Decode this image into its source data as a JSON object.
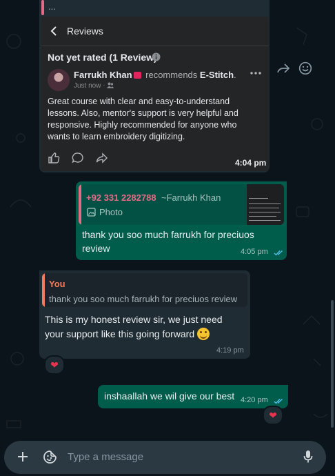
{
  "colors": {
    "chat_background": "#0b141a",
    "incoming_bubble": "#202c33",
    "outgoing_bubble": "#005c4b",
    "quote_pink": "#e26b86",
    "quote_orange": "#f27c59",
    "read_ticks": "#53bdeb",
    "heart": "#e8344e"
  },
  "top_message": {
    "quote_snippet": "...",
    "screenshot": {
      "header_title": "Reviews",
      "rating_line": "Not yet rated (1 Review)",
      "reviewer_name": "Farrukh Khan",
      "recommends_word": "recommends",
      "page_name": "E-Stitch",
      "posted_time": "Just now ·",
      "review_text": "Great course with clear and easy-to-understand lessons. Also, mentor's support is very helpful and responsive. Highly recommended for anyone who wants to learn embroidery digitizing."
    },
    "time": "4:04 pm",
    "side_icons": [
      "forward-icon",
      "emoji-reaction-icon"
    ]
  },
  "reply_message": {
    "quoted_phone": "+92 331 2282788",
    "quoted_name": "~Farrukh Khan",
    "quoted_type": "Photo",
    "text": "thank you soo much farrukh for preciuos review",
    "time": "4:05 pm",
    "status": "read"
  },
  "incoming_reply": {
    "quoted_author": "You",
    "quoted_text": "thank you soo much farrukh for preciuos review",
    "text": "This is my honest review sir, we just need your support like this going forward",
    "emoji": "smiling-face",
    "time": "4:19 pm",
    "reaction": "❤"
  },
  "last_message": {
    "text": "inshaallah we wil give our best",
    "time": "4:20 pm",
    "status": "read",
    "reaction": "❤"
  },
  "composer": {
    "placeholder": "Type a message"
  }
}
